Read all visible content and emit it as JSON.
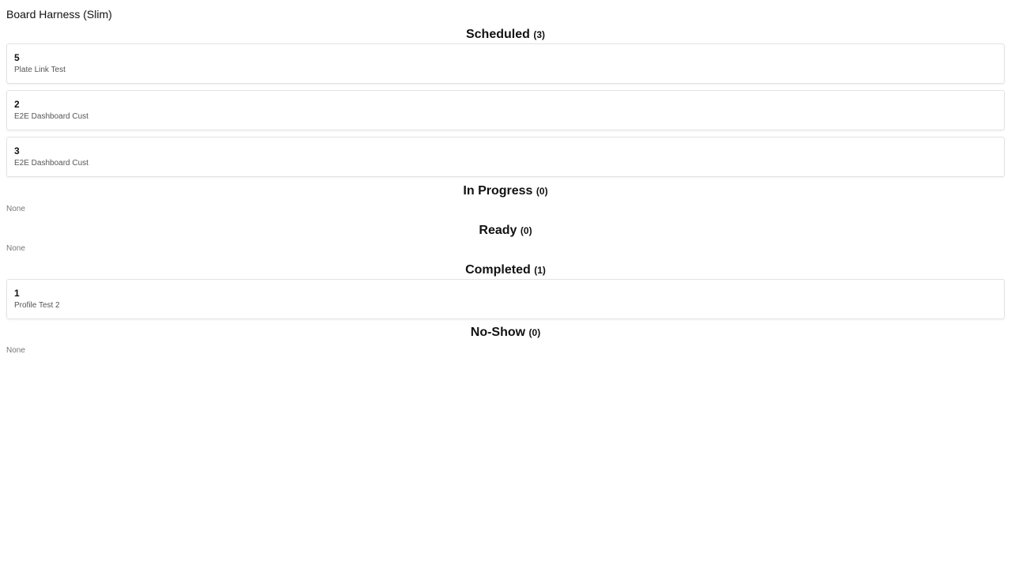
{
  "app": {
    "title": "Board Harness (Slim)"
  },
  "sections": {
    "scheduled": {
      "label": "Scheduled",
      "count": "(3)",
      "items": [
        {
          "id": "5",
          "name": "Plate Link Test"
        },
        {
          "id": "2",
          "name": "E2E Dashboard Cust"
        },
        {
          "id": "3",
          "name": "E2E Dashboard Cust"
        }
      ]
    },
    "in_progress": {
      "label": "In Progress",
      "count": "(0)",
      "empty": "None"
    },
    "ready": {
      "label": "Ready",
      "count": "(0)",
      "empty": "None"
    },
    "completed": {
      "label": "Completed",
      "count": "(1)",
      "items": [
        {
          "id": "1",
          "name": "Profile Test 2"
        }
      ]
    },
    "no_show": {
      "label": "No-Show",
      "count": "(0)",
      "empty": "None"
    }
  },
  "colors": {
    "text": "#111111",
    "muted": "#555555",
    "card_border": "#e3e3e3",
    "background": "#ffffff"
  }
}
